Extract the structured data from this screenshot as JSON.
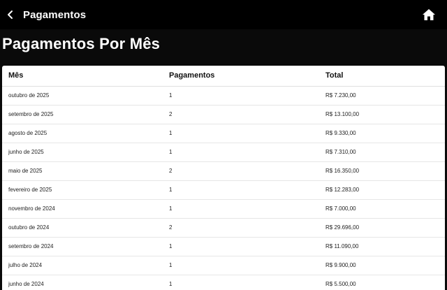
{
  "appbar": {
    "title": "Pagamentos",
    "back_icon": "chevron-left-icon",
    "home_icon": "home-icon"
  },
  "heading": "Pagamentos Por Mês",
  "table": {
    "headers": [
      "Mês",
      "Pagamentos",
      "Total"
    ],
    "rows": [
      [
        "outubro de 2025",
        "1",
        "R$ 7.230,00"
      ],
      [
        "setembro de 2025",
        "2",
        "R$ 13.100,00"
      ],
      [
        "agosto de 2025",
        "1",
        "R$ 9.330,00"
      ],
      [
        "junho de 2025",
        "1",
        "R$ 7.310,00"
      ],
      [
        "maio de 2025",
        "2",
        "R$ 16.350,00"
      ],
      [
        "fevereiro de 2025",
        "1",
        "R$ 12.283,00"
      ],
      [
        "novembro de 2024",
        "1",
        "R$ 7.000,00"
      ],
      [
        "outubro de 2024",
        "2",
        "R$ 29.696,00"
      ],
      [
        "setembro de 2024",
        "1",
        "R$ 11.090,00"
      ],
      [
        "julho de 2024",
        "1",
        "R$ 9.900,00"
      ],
      [
        "junho de 2024",
        "1",
        "R$ 5.500,00"
      ]
    ]
  },
  "colors": {
    "appbar_bg": "#000000",
    "page_bg": "#0a0a0a",
    "card_bg": "#ffffff"
  }
}
